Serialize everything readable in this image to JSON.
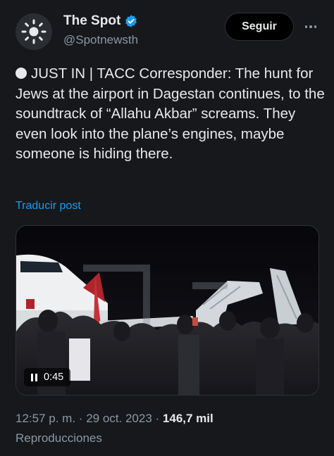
{
  "author": {
    "name": "The Spot",
    "handle": "@Spotnewsth",
    "avatar_icon": "sun-burst-icon",
    "verified_icon": "verified-badge-icon",
    "verified_color": "#1d9bf0"
  },
  "actions": {
    "follow_label": "Seguir",
    "more_icon": "more-horizontal-icon"
  },
  "post": {
    "bullet_icon": "white-circle-icon",
    "text": "JUST IN | TACC Corresponder: The hunt for Jews at the airport in Dagestan continues, to the soundtrack of “Allahu Akbar” screams. They even look into the plane’s engines, maybe someone is hiding there.",
    "translate_label": "Traducir post"
  },
  "media": {
    "type": "video",
    "duration": "0:45",
    "control_icon": "pause-icon"
  },
  "meta": {
    "time": "12:57 p. m.",
    "separator": "·",
    "date": "29 oct. 2023",
    "views_count": "146,7 mil",
    "views_label": "Reproducciones"
  },
  "colors": {
    "background": "#16181c",
    "text": "#e7e9ea",
    "secondary": "#8b98a5",
    "link": "#1d9bf0"
  }
}
